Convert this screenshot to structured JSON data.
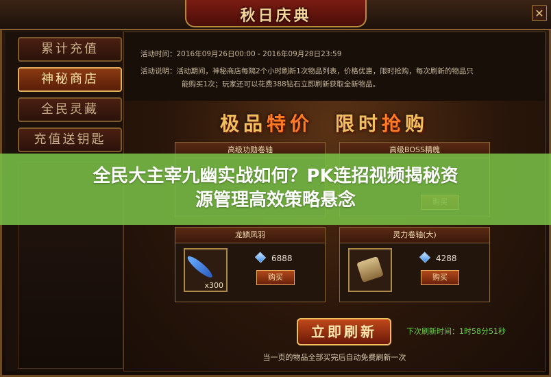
{
  "window": {
    "title": "秋日庆典",
    "close_label": "✕"
  },
  "sidebar": {
    "items": [
      {
        "label": "累计充值",
        "active": false
      },
      {
        "label": "神秘商店",
        "active": true
      },
      {
        "label": "全民灵藏",
        "active": false
      },
      {
        "label": "充值送钥匙",
        "active": false
      }
    ]
  },
  "event": {
    "time_label": "活动时间：",
    "time_value": "2016年09月26日00:00 - 2016年09月28日23:59",
    "desc_label": "活动说明：",
    "desc_line1": "活动期间，神秘商店每隔2个小时刷新1次物品列表，价格优惠，限时抢购，每次刷新的物品只",
    "desc_line2": "能购买1次；玩家还可以花费388钻石立即刷新获取全新物品。"
  },
  "banner": {
    "title_a": "极品",
    "title_b": "特价",
    "title_c": "限时",
    "title_d": "抢",
    "title_e": "购"
  },
  "shop": {
    "items": [
      {
        "name": "高级功勋卷轴",
        "price": "",
        "count": "",
        "buy_label": ""
      },
      {
        "name": "高级BOSS精魄",
        "price": "",
        "count": "",
        "buy_label": "购买"
      },
      {
        "name": "龙鳞凤羽",
        "price": "6888",
        "count": "x300",
        "buy_label": "购买"
      },
      {
        "name": "灵力卷轴(大)",
        "price": "4288",
        "count": "",
        "buy_label": "购买"
      }
    ]
  },
  "footer": {
    "refresh_label": "立即刷新",
    "next_refresh_label": "下次刷新时间：",
    "next_refresh_value": "1时58分51秒",
    "note": "当一页的物品全部买完后自动免费刷新一次"
  },
  "overlay": {
    "line1": "全民大主宰九幽实战如何？PK连招视频揭秘资",
    "line2": "源管理高效策略悬念"
  },
  "colors": {
    "accent_gold": "#f0c060",
    "refresh_green": "#6cd24a",
    "overlay_green": "#78be46"
  }
}
